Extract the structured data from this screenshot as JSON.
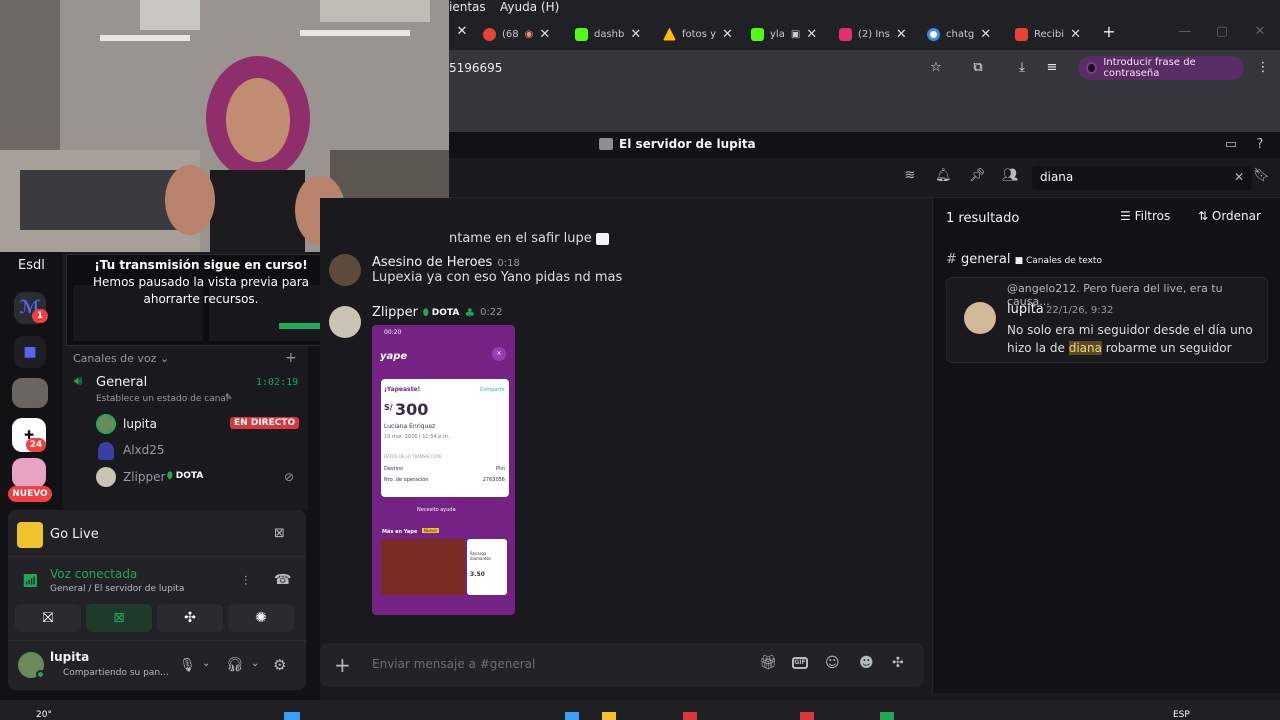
{
  "chrome": {
    "menu": [
      "ientas",
      "Ayuda (H)"
    ],
    "tabs": [
      {
        "label": "(68",
        "color": "#e94235"
      },
      {
        "label": "dashb",
        "color": "#53fc18"
      },
      {
        "label": "fotos y",
        "color": "#fbbc04"
      },
      {
        "label": "yla",
        "color": "#53fc18"
      },
      {
        "label": "(2) Ins",
        "color": "#e1306c"
      },
      {
        "label": "chatg",
        "color": "#4285f4"
      },
      {
        "label": "Recibi",
        "color": "#ea4335"
      }
    ],
    "address": "5196695",
    "passphrase": "Introducir frase de contraseña"
  },
  "discord": {
    "server_title": "El servidor de lupita",
    "search_query": "diana",
    "preview": {
      "title": "¡Tu transmisión sigue en curso!",
      "body": "Hemos pausado la vista previa para ahorrarte recursos."
    },
    "server_label": "Esdl",
    "badges": {
      "guild1": "1",
      "guild2": "24",
      "nuevo": "NUEVO"
    },
    "voice_category": "Canales de voz",
    "voice_channel": {
      "name": "General",
      "timer": "1:02:19",
      "status": "Establece un estado de canal"
    },
    "voice_users": [
      {
        "name": "lupita",
        "tag": "EN DIRECTO"
      },
      {
        "name": "Alxd25",
        "tag": ""
      },
      {
        "name": "Zlipper",
        "tag": "DOTA"
      }
    ],
    "go_live": "Go Live",
    "voice_connected": "Voz conectada",
    "voice_path": "General / El servidor de lupita",
    "user": {
      "name": "lupita",
      "status": "Compartiendo su pan..."
    },
    "messages": [
      {
        "text": "ntame en el safir lupe"
      },
      {
        "author": "Asesino de Heroes",
        "time": "0:18",
        "text": "Lupexia ya con eso Yano pidas nd mas"
      },
      {
        "author": "Zlipper",
        "badge": "DOTA",
        "time": "0:22"
      }
    ],
    "yape": {
      "time": "00:20",
      "paid": "¡Yapeaste!",
      "share": "Compartir",
      "currency": "S/",
      "amount": "300",
      "recipient": "Luciana Enriquez",
      "date": "19 mar. 2026 | 11:54 p.m.",
      "section": "DATOS DE LA TRANSACCIÓN",
      "destino_label": "Destino",
      "destino": "Plin",
      "op_label": "Nro. de operación",
      "op": "2763056",
      "help": "Necesito ayuda",
      "more": "Más en Yape",
      "promo_tag": "Nuevo",
      "promo_title": "Recarga diamantes",
      "promo_price": "3.50"
    },
    "composer_placeholder": "Enviar mensaje a #general",
    "results": {
      "count": "1 resultado",
      "filters": "Filtros",
      "sort": "Ordenar",
      "channel": "general",
      "channel_type": "Canales de texto",
      "reply_to": "@angelo212. Pero fuera del live, era tu causa...",
      "author": "lupita",
      "time": "22/1/26, 9:32",
      "text_before": "No solo era mi seguidor desde el día uno hizo la de ",
      "highlight": "diana",
      "text_after": " robarme un seguidor"
    }
  },
  "taskbar": {
    "temp": "20°",
    "lang": "ESP"
  },
  "colors": {
    "accent": "#5865f2",
    "live": "#da373c",
    "online": "#23a55a",
    "yape": "#742284"
  }
}
